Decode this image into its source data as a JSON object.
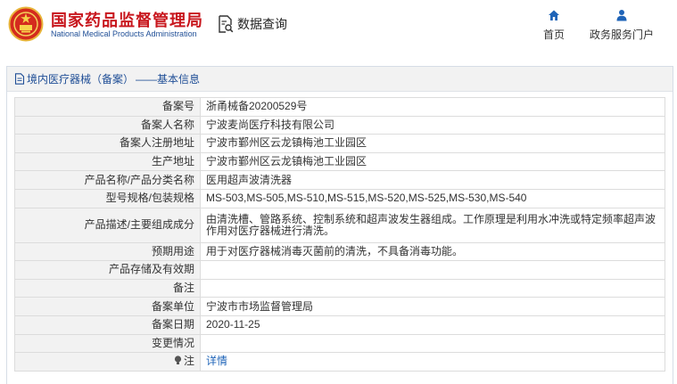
{
  "header": {
    "brand_cn": "国家药品监督管理局",
    "brand_en": "National Medical Products Administration",
    "query_label": "数据查询",
    "nav": {
      "home": "首页",
      "gov": "政务服务门户"
    }
  },
  "breadcrumb": {
    "section": "境内医疗器械（备案）",
    "separator": "——",
    "current": "基本信息"
  },
  "record": {
    "rows": [
      {
        "label": "备案号",
        "value": "浙甬械备20200529号"
      },
      {
        "label": "备案人名称",
        "value": "宁波麦尚医疗科技有限公司"
      },
      {
        "label": "备案人注册地址",
        "value": "宁波市鄞州区云龙镇梅池工业园区"
      },
      {
        "label": "生产地址",
        "value": "宁波市鄞州区云龙镇梅池工业园区"
      },
      {
        "label": "产品名称/产品分类名称",
        "value": "医用超声波清洗器"
      },
      {
        "label": "型号规格/包装规格",
        "value": "MS-503,MS-505,MS-510,MS-515,MS-520,MS-525,MS-530,MS-540"
      },
      {
        "label": "产品描述/主要组成成分",
        "value": "由清洗槽、管路系统、控制系统和超声波发生器组成。工作原理是利用水冲洗或特定频率超声波作用对医疗器械进行清洗。"
      },
      {
        "label": "预期用途",
        "value": "用于对医疗器械消毒灭菌前的清洗，不具备消毒功能。"
      },
      {
        "label": "产品存储及有效期",
        "value": ""
      },
      {
        "label": "备注",
        "value": ""
      },
      {
        "label": "备案单位",
        "value": "宁波市市场监督管理局"
      },
      {
        "label": "备案日期",
        "value": "2020-11-25"
      },
      {
        "label": "变更情况",
        "value": ""
      },
      {
        "label": "注",
        "value": "详情"
      }
    ]
  },
  "colors": {
    "brand_red": "#c8161d",
    "brand_blue": "#1f4e96",
    "link_blue": "#1f64b8",
    "label_bg": "#f2f2f2"
  },
  "icons": {
    "emblem": "national-emblem",
    "query": "document-search-icon",
    "home": "home-icon",
    "gov": "user-icon",
    "crumb": "document-icon",
    "note": "lightbulb-icon"
  }
}
